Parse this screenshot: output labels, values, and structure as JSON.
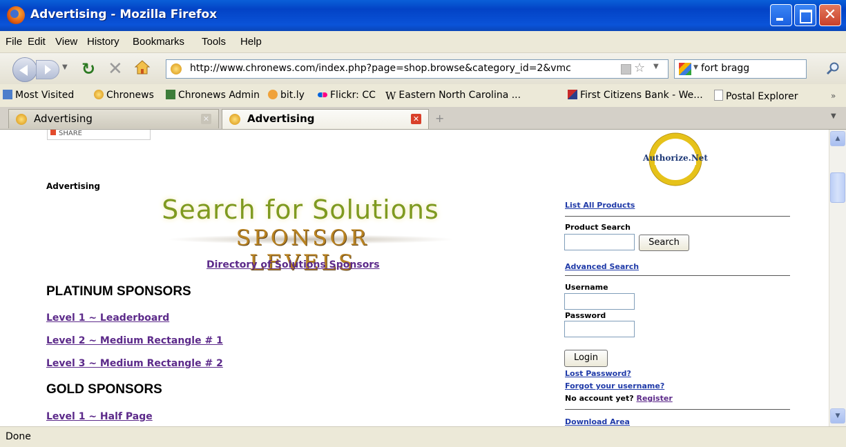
{
  "window": {
    "title": "Advertising - Mozilla Firefox"
  },
  "menu": [
    "File",
    "Edit",
    "View",
    "History",
    "Bookmarks",
    "Tools",
    "Help"
  ],
  "navbar": {
    "url": "http://www.chronews.com/index.php?page=shop.browse&category_id=2&vmc",
    "search_value": "fort bragg"
  },
  "bookmarks": [
    {
      "label": "Most Visited",
      "icon": "most-visited-icon"
    },
    {
      "label": "Chronews",
      "icon": "chronews-icon"
    },
    {
      "label": "Chronews Admin",
      "icon": "chronews-admin-icon"
    },
    {
      "label": "bit.ly",
      "icon": "bitly-icon"
    },
    {
      "label": "Flickr: CC",
      "icon": "flickr-icon"
    },
    {
      "label": "Eastern North Carolina ...",
      "icon": "wikipedia-icon"
    },
    {
      "label": "First Citizens Bank - We...",
      "icon": "bank-icon"
    },
    {
      "label": "Postal Explorer",
      "icon": "page-icon"
    }
  ],
  "tabs": [
    {
      "label": "Advertising",
      "active": false
    },
    {
      "label": "Advertising",
      "active": true
    }
  ],
  "content": {
    "share_label": "SHARE",
    "heading": "Advertising",
    "banner_line1": "Search for Solutions",
    "banner_line2": "SPONSOR LEVELS",
    "directory_link": "Directory of Solutions Sponsors",
    "platinum_heading": "PLATINUM SPONSORS",
    "platinum_links": [
      "Level 1 ~ Leaderboard",
      "Level 2 ~ Medium Rectangle # 1",
      "Level 3 ~ Medium Rectangle # 2"
    ],
    "gold_heading": "GOLD SPONSORS",
    "gold_links": [
      "Level 1 ~ Half Page"
    ]
  },
  "sidebar": {
    "badge_text": "Authorize.Net",
    "list_all_products": "List All Products",
    "product_search_label": "Product Search",
    "search_button": "Search",
    "advanced_search": "Advanced Search",
    "username_label": "Username",
    "password_label": "Password",
    "login_button": "Login",
    "lost_password": "Lost Password?",
    "forgot_username": "Forgot your username?",
    "no_account": "No account yet?",
    "register": "Register",
    "download_area": "Download Area"
  },
  "status": {
    "text": "Done"
  },
  "colors": {
    "titlebar": "#0a53d8",
    "visited_link": "#5c2a8a",
    "link": "#1f3aa8"
  }
}
